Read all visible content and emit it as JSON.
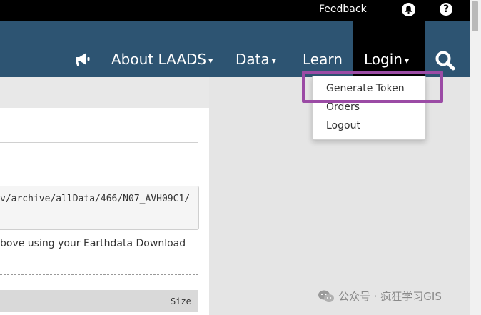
{
  "topbar": {
    "feedback_label": "Feedback",
    "bell_icon": "bell-icon",
    "help_icon": "question-icon",
    "help_glyph": "?"
  },
  "navbar": {
    "announcement_icon": "megaphone-icon",
    "items": [
      {
        "label": "About LAADS",
        "caret": "▾"
      },
      {
        "label": "Data",
        "caret": "▾"
      },
      {
        "label": "Learn"
      },
      {
        "label": "Login",
        "caret": "▾"
      }
    ],
    "search_icon": "search-icon"
  },
  "login_menu": {
    "items": [
      "Generate Token",
      "Orders",
      "Logout"
    ]
  },
  "content": {
    "path_text": "v/archive/allData/466/N07_AVH09C1/",
    "hint_text": "bove using your Earthdata Download",
    "table_header_size": "Size"
  },
  "watermark": {
    "text": "公众号 · 疯狂学习GIS"
  },
  "colors": {
    "navbar": "#2d5472",
    "topbar": "#000000",
    "highlight": "#9b4ba5",
    "active_nav": "#000000"
  }
}
